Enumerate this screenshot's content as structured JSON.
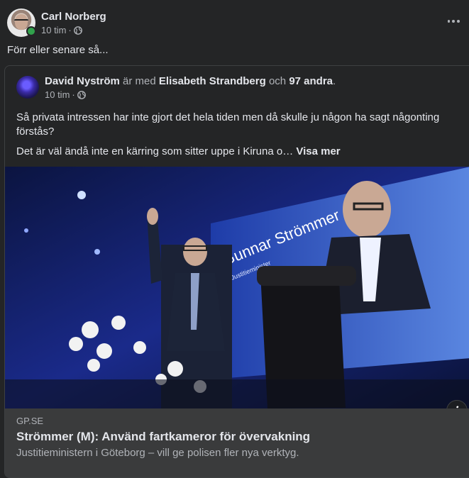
{
  "post": {
    "author": "Carl Norberg",
    "time": "10 tim",
    "separator": "·",
    "text": "Förr eller senare så..."
  },
  "shared": {
    "author": "David Nyström",
    "with_text": "är med",
    "tagged": "Elisabeth Strandberg",
    "and_text": "och",
    "others": "97 andra",
    "period": ".",
    "time": "10 tim",
    "separator": "·",
    "paragraph1": "Så privata intressen har inte gjort det hela tiden men då skulle ju någon ha sagt någonting förstås?",
    "paragraph2": "Det är väl ändå inte en kärring som sitter uppe i Kiruna o…",
    "see_more": "Visa mer"
  },
  "link": {
    "image_screen_name": "Gunnar Strömmer",
    "image_screen_role": "Justitieminister",
    "info_glyph": "i",
    "domain": "GP.SE",
    "title": "Strömmer (M): Använd fartkameror för övervakning",
    "description": "Justitieministern i Göteborg – vill ge polisen fler nya verktyg."
  },
  "colors": {
    "background": "#242526",
    "text_primary": "#e4e6eb",
    "text_secondary": "#b0b3b8",
    "online": "#31a24c",
    "link_meta_bg": "#3a3b3c"
  },
  "icons": [
    "globe-icon",
    "more-icon",
    "info-icon",
    "online-status-icon"
  ]
}
